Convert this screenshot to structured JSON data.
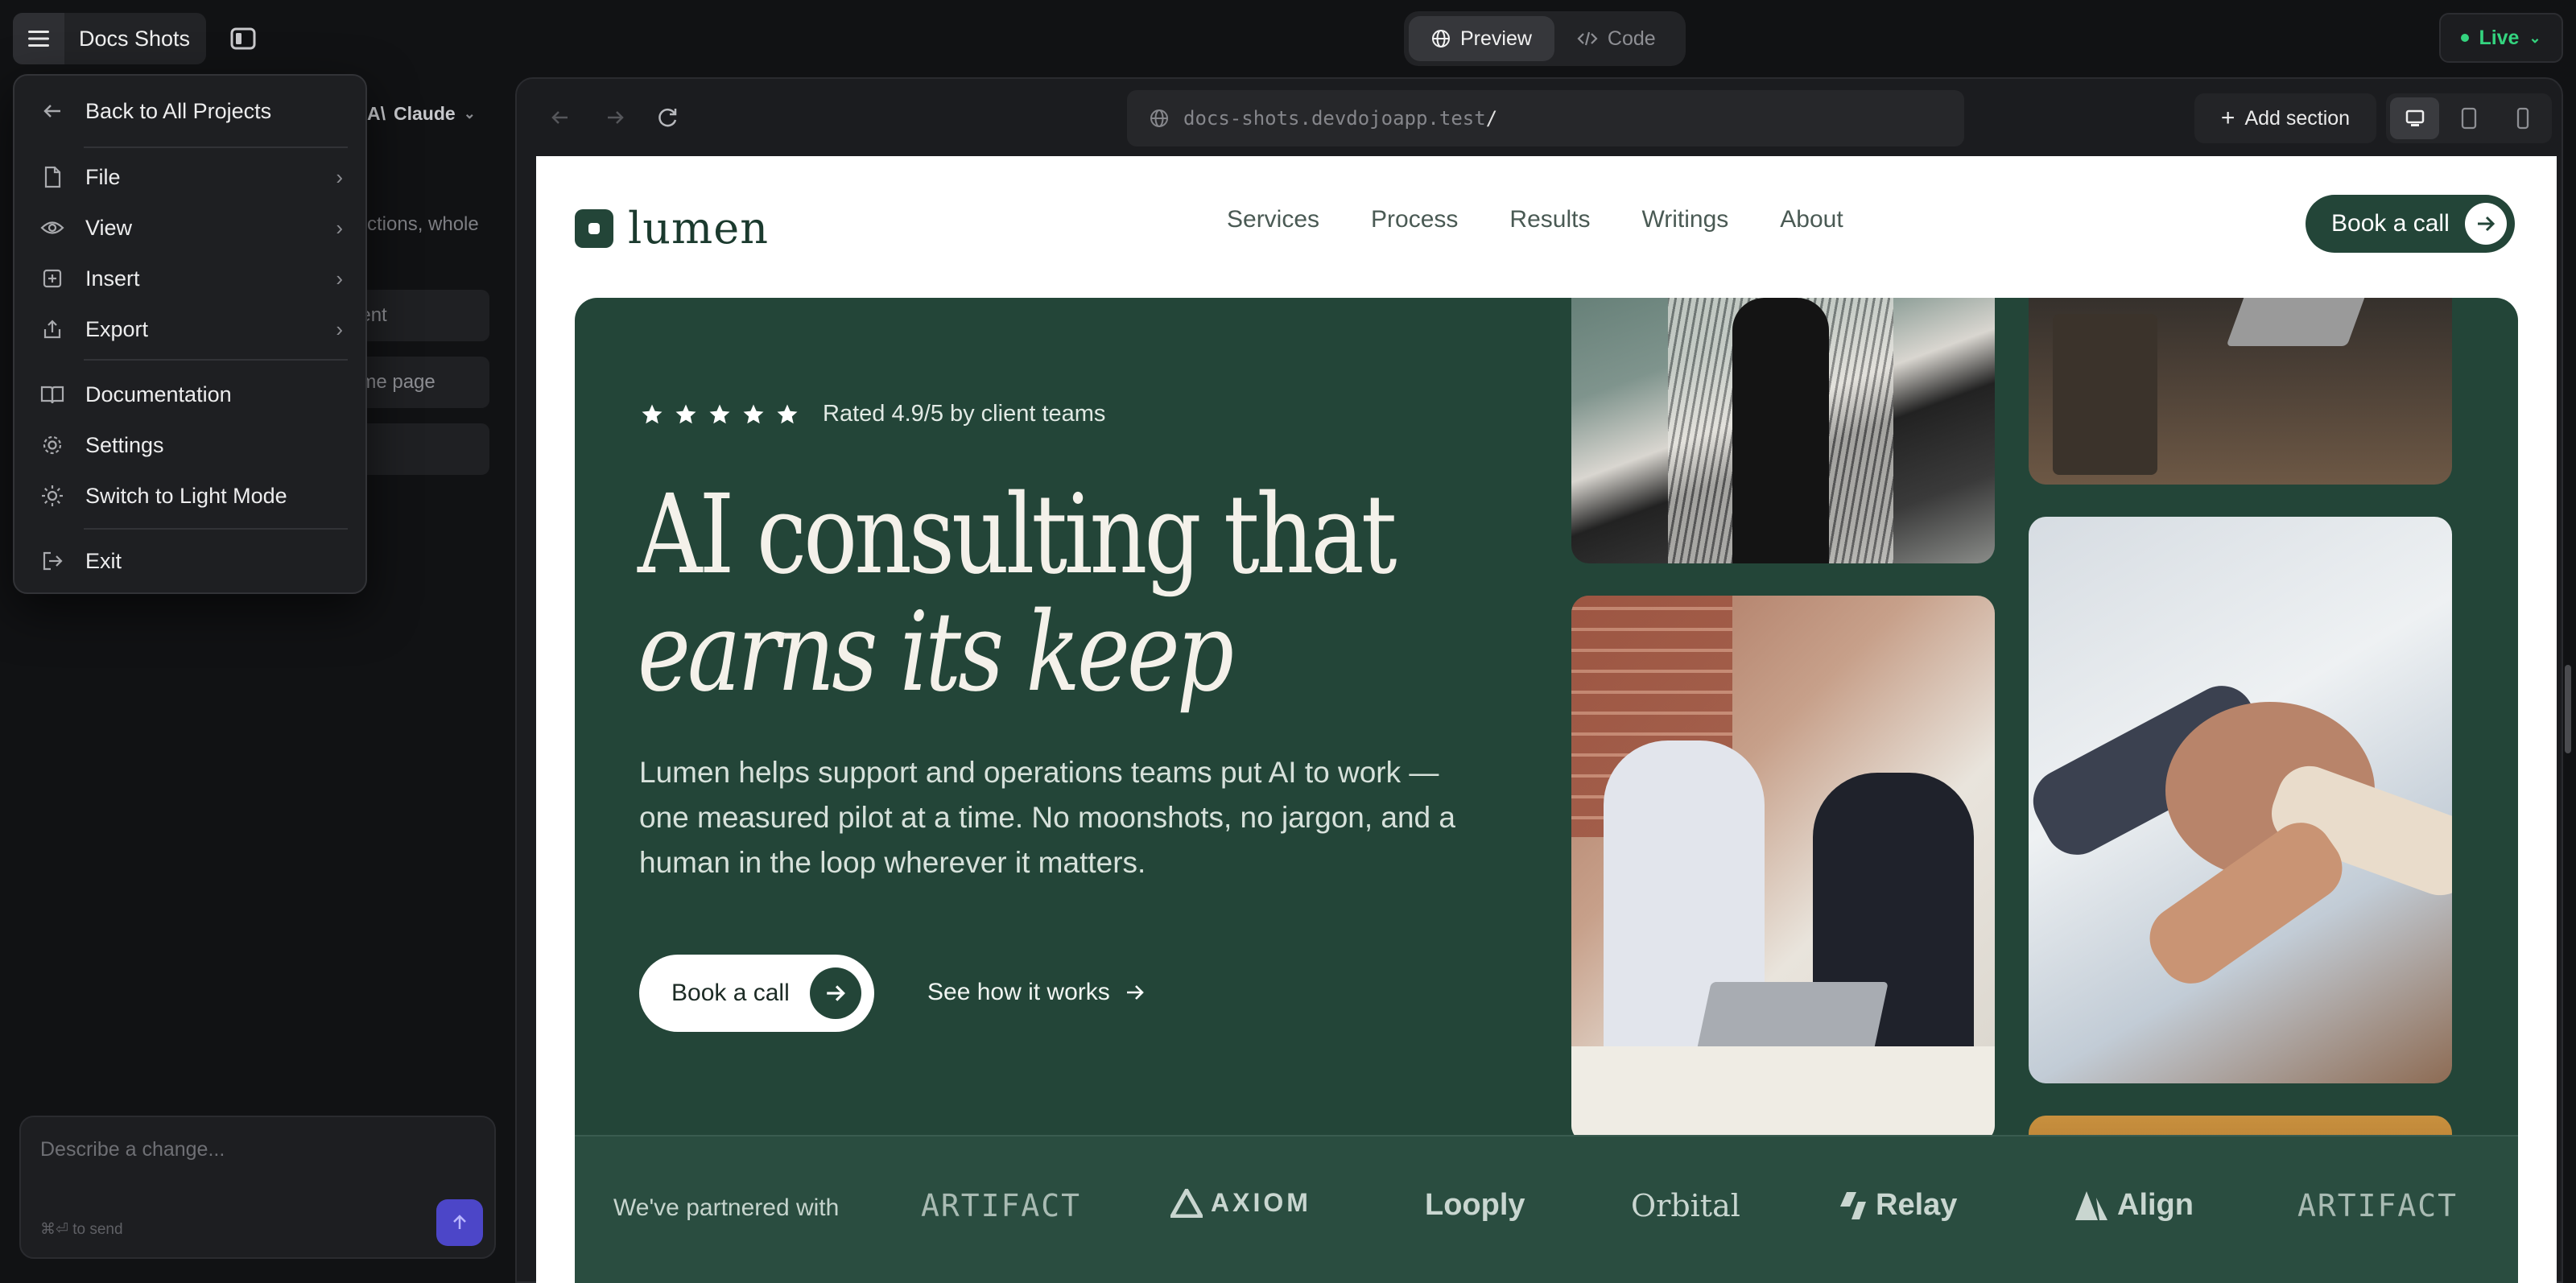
{
  "topbar": {
    "project_title": "Docs Shots",
    "mode_tabs": [
      {
        "label": "Preview",
        "active": true
      },
      {
        "label": "Code",
        "active": false
      }
    ],
    "live_label": "Live",
    "live_color": "#34d47f"
  },
  "sidebar": {
    "model_label": "Claude",
    "hint_fragment": "ctions, whole",
    "rows": [
      "dent",
      "ome page",
      ""
    ],
    "chat": {
      "placeholder": "Describe a change...",
      "send_hint": "⌘⏎ to send"
    }
  },
  "app_menu": {
    "back": "Back to All Projects",
    "items": [
      {
        "label": "File",
        "icon": "file-icon",
        "submenu": true
      },
      {
        "label": "View",
        "icon": "eye-icon",
        "submenu": true
      },
      {
        "label": "Insert",
        "icon": "plus-square-icon",
        "submenu": true
      },
      {
        "label": "Export",
        "icon": "upload-icon",
        "submenu": true
      }
    ],
    "items2": [
      {
        "label": "Documentation",
        "icon": "book-icon"
      },
      {
        "label": "Settings",
        "icon": "gear-icon"
      },
      {
        "label": "Switch to Light Mode",
        "icon": "sun-icon"
      }
    ],
    "exit": "Exit"
  },
  "browser": {
    "url_host": "docs-shots.devdojoapp.test",
    "url_path": "/",
    "add_section": "Add section",
    "devices": [
      "desktop-icon",
      "tablet-icon",
      "mobile-icon"
    ]
  },
  "site": {
    "brand": "lumen",
    "brand_color": "#234538",
    "nav": [
      "Services",
      "Process",
      "Results",
      "Writings",
      "About"
    ],
    "nav_cta": "Book a call",
    "hero": {
      "rating": "Rated 4.9/5 by client teams",
      "stars": 5,
      "headline_line1": "AI consulting that",
      "headline_line2": "earns its keep",
      "body": "Lumen helps support and operations teams put AI to work — one measured pilot at a time. No moonshots, no jargon, and a human in the loop wherever it matters.",
      "cta_primary": "Book a call",
      "cta_secondary": "See how it works"
    },
    "partners_label": "We've partnered with",
    "partners": [
      "ARTIFACT",
      "AXIOM",
      "Looply",
      "Orbital",
      "Relay",
      "Align",
      "ARTIFACT"
    ]
  }
}
